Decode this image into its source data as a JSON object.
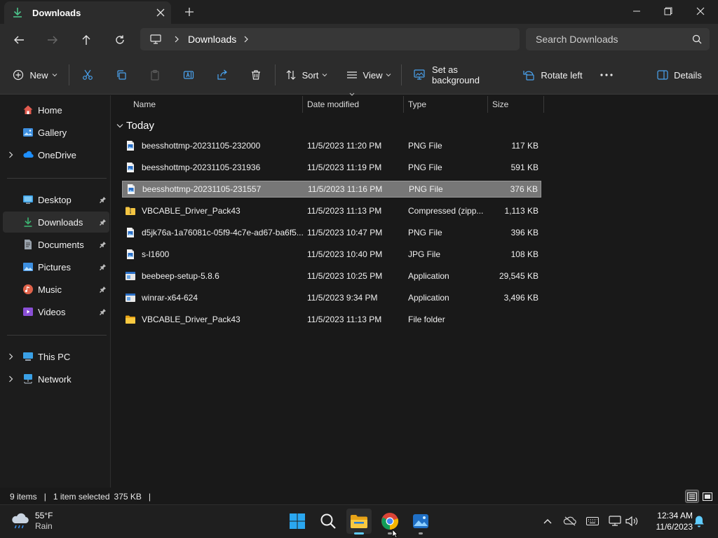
{
  "window": {
    "tab_title": "Downloads",
    "new_tab_label": "+"
  },
  "address": {
    "crumbs": [
      "Downloads"
    ],
    "search_placeholder": "Search Downloads"
  },
  "commands": {
    "new_label": "New",
    "sort_label": "Sort",
    "view_label": "View",
    "set_background_label": "Set as background",
    "rotate_left_label": "Rotate left",
    "details_label": "Details"
  },
  "sidebar": {
    "items": [
      {
        "label": "Home",
        "icon": "home-icon",
        "color": "#e25b4f"
      },
      {
        "label": "Gallery",
        "icon": "gallery-icon",
        "color": "#3d8fe0"
      },
      {
        "label": "OneDrive",
        "icon": "onedrive-icon",
        "color": "#1e90ff"
      },
      {
        "label": "Desktop",
        "icon": "desktop-icon",
        "color": "#3aa0e6"
      },
      {
        "label": "Downloads",
        "icon": "downloads-icon",
        "color": "#3cb371"
      },
      {
        "label": "Documents",
        "icon": "documents-icon",
        "color": "#9aa3ad"
      },
      {
        "label": "Pictures",
        "icon": "pictures-icon",
        "color": "#3d8fe0"
      },
      {
        "label": "Music",
        "icon": "music-icon",
        "color": "#e0624a"
      },
      {
        "label": "Videos",
        "icon": "videos-icon",
        "color": "#8a4fd6"
      },
      {
        "label": "This PC",
        "icon": "this-pc-icon",
        "color": "#3aa0e6"
      },
      {
        "label": "Network",
        "icon": "network-icon",
        "color": "#3aa0e6"
      }
    ]
  },
  "columns": {
    "name": "Name",
    "date": "Date modified",
    "type": "Type",
    "size": "Size"
  },
  "group_label": "Today",
  "files": [
    {
      "name": "beesshottmp-20231105-232000",
      "date": "11/5/2023 11:20 PM",
      "type": "PNG File",
      "size": "117 KB",
      "icon": "image-file-icon"
    },
    {
      "name": "beesshottmp-20231105-231936",
      "date": "11/5/2023 11:19 PM",
      "type": "PNG File",
      "size": "591 KB",
      "icon": "image-file-icon"
    },
    {
      "name": "beesshottmp-20231105-231557",
      "date": "11/5/2023 11:16 PM",
      "type": "PNG File",
      "size": "376 KB",
      "icon": "image-file-icon"
    },
    {
      "name": "VBCABLE_Driver_Pack43",
      "date": "11/5/2023 11:13 PM",
      "type": "Compressed (zipp...",
      "size": "1,113 KB",
      "icon": "zip-folder-icon"
    },
    {
      "name": "d5jk76a-1a76081c-05f9-4c7e-ad67-ba6f5...",
      "date": "11/5/2023 10:47 PM",
      "type": "PNG File",
      "size": "396 KB",
      "icon": "image-file-icon"
    },
    {
      "name": "s-l1600",
      "date": "11/5/2023 10:40 PM",
      "type": "JPG File",
      "size": "108 KB",
      "icon": "image-file-icon"
    },
    {
      "name": "beebeep-setup-5.8.6",
      "date": "11/5/2023 10:25 PM",
      "type": "Application",
      "size": "29,545 KB",
      "icon": "application-icon"
    },
    {
      "name": "winrar-x64-624",
      "date": "11/5/2023 9:34 PM",
      "type": "Application",
      "size": "3,496 KB",
      "icon": "application-icon"
    },
    {
      "name": "VBCABLE_Driver_Pack43",
      "date": "11/5/2023 11:13 PM",
      "type": "File folder",
      "size": "",
      "icon": "folder-icon"
    }
  ],
  "selected_index": 2,
  "status": {
    "count": "9 items",
    "selection": "1 item selected",
    "selection_size": "375 KB"
  },
  "taskbar": {
    "weather_temp": "55°F",
    "weather_cond": "Rain",
    "time": "12:34 AM",
    "date": "11/6/2023"
  },
  "colors": {
    "accent": "#60cdff",
    "folder": "#f4c542",
    "selection": "#777777"
  }
}
